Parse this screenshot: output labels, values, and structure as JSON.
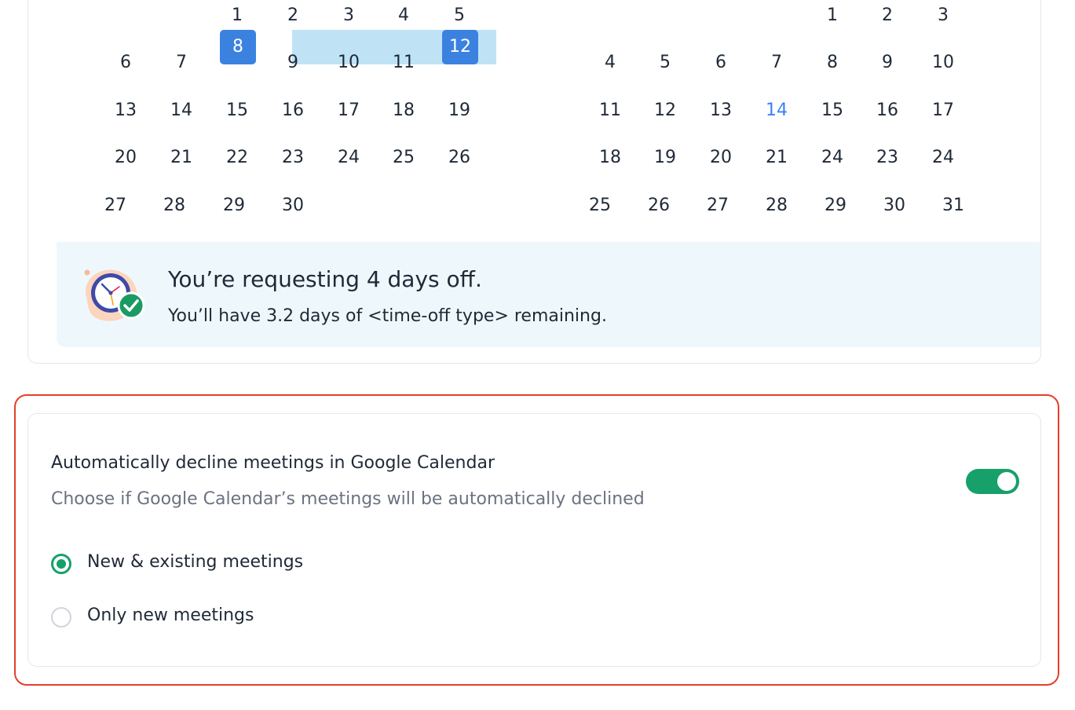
{
  "calendar": {
    "left_month": {
      "rows": [
        [
          "1",
          "2",
          "3",
          "4",
          "5"
        ],
        [
          "6",
          "7",
          "8",
          "9",
          "10",
          "11",
          "12"
        ],
        [
          "13",
          "14",
          "15",
          "16",
          "17",
          "18",
          "19"
        ],
        [
          "20",
          "21",
          "22",
          "23",
          "24",
          "25",
          "26"
        ],
        [
          "27",
          "28",
          "29",
          "30"
        ]
      ],
      "range_start": "8",
      "range_end": "12"
    },
    "right_month": {
      "rows": [
        [
          "1",
          "2",
          "3"
        ],
        [
          "4",
          "5",
          "6",
          "7",
          "8",
          "9",
          "10"
        ],
        [
          "11",
          "12",
          "13",
          "14",
          "15",
          "16",
          "17"
        ],
        [
          "18",
          "19",
          "20",
          "21",
          "24",
          "23",
          "24"
        ],
        [
          "25",
          "26",
          "27",
          "28",
          "29",
          "30",
          "31"
        ]
      ],
      "today": "14"
    }
  },
  "summary": {
    "title": "You’re requesting 4 days off.",
    "subtitle": "You’ll have 3.2 days of <time-off type> remaining.",
    "illustration_icon": "clock-check-icon"
  },
  "decline_setting": {
    "title": "Automatically decline meetings in Google Calendar",
    "description": "Choose if Google Calendar’s meetings will be automatically declined",
    "toggle_on": true,
    "options": [
      {
        "label": "New & existing meetings",
        "selected": true
      },
      {
        "label": "Only new meetings",
        "selected": false
      }
    ]
  },
  "colors": {
    "range_end": "#3b82e0",
    "range_fill": "#bfe3f5",
    "today_text": "#3b82f6",
    "toggle_on": "#17a06a",
    "highlight_border": "#e63d2a",
    "banner_bg": "#eef8fc"
  }
}
